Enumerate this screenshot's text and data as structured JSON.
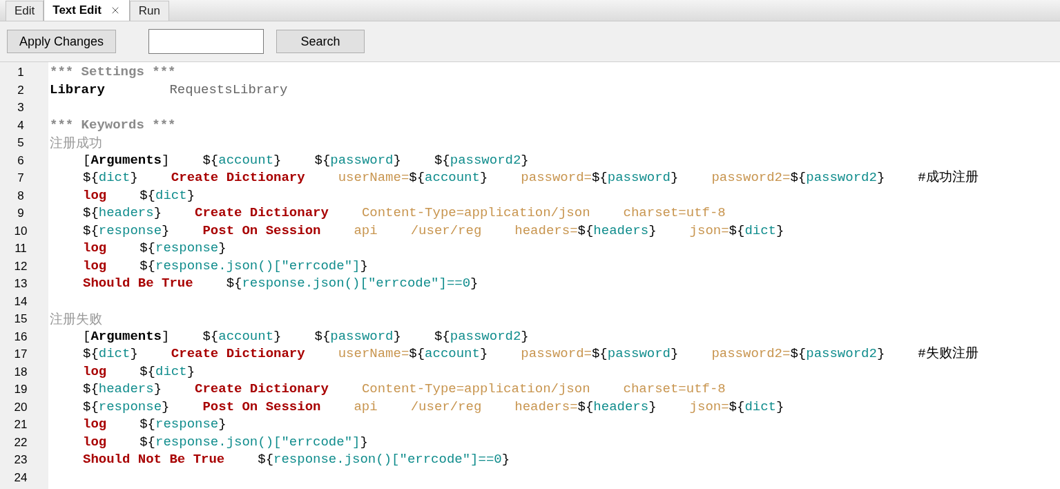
{
  "tabs": [
    {
      "label": "Edit",
      "selected": false
    },
    {
      "label": "Text Edit",
      "selected": true
    },
    {
      "label": "Run",
      "selected": false
    }
  ],
  "toolbar": {
    "apply_button": "Apply Changes",
    "search_button": "Search"
  },
  "editor": {
    "lines": [
      {
        "number": "1",
        "indented": false,
        "cells": [
          [
            {
              "kind": "section",
              "text": "*** Settings ***"
            }
          ]
        ]
      },
      {
        "number": "2",
        "indented": false,
        "cells": [
          [
            {
              "kind": "setting",
              "text": "Library"
            }
          ],
          [
            {
              "kind": "plain",
              "text": "    RequestsLibrary"
            }
          ]
        ]
      },
      {
        "number": "3"
      },
      {
        "number": "4",
        "indented": false,
        "cells": [
          [
            {
              "kind": "section",
              "text": "*** Keywords ***"
            }
          ]
        ]
      },
      {
        "number": "5",
        "indented": false,
        "cells": [
          [
            {
              "kind": "name",
              "text": "注册成功"
            }
          ]
        ]
      },
      {
        "number": "6",
        "indented": true,
        "cells": [
          [
            {
              "kind": "brace",
              "text": "["
            },
            {
              "kind": "setting",
              "text": "Arguments"
            },
            {
              "kind": "brace",
              "text": "]"
            }
          ],
          [
            {
              "kind": "brace",
              "text": "${"
            },
            {
              "kind": "var",
              "text": "account"
            },
            {
              "kind": "brace",
              "text": "}"
            }
          ],
          [
            {
              "kind": "brace",
              "text": "${"
            },
            {
              "kind": "var",
              "text": "password"
            },
            {
              "kind": "brace",
              "text": "}"
            }
          ],
          [
            {
              "kind": "brace",
              "text": "${"
            },
            {
              "kind": "var",
              "text": "password2"
            },
            {
              "kind": "brace",
              "text": "}"
            }
          ]
        ]
      },
      {
        "number": "7",
        "indented": true,
        "cells": [
          [
            {
              "kind": "brace",
              "text": "${"
            },
            {
              "kind": "var",
              "text": "dict"
            },
            {
              "kind": "brace",
              "text": "}"
            }
          ],
          [
            {
              "kind": "keyword",
              "text": "Create Dictionary"
            }
          ],
          [
            {
              "kind": "arg",
              "text": "userName="
            },
            {
              "kind": "brace",
              "text": "${"
            },
            {
              "kind": "var",
              "text": "account"
            },
            {
              "kind": "brace",
              "text": "}"
            }
          ],
          [
            {
              "kind": "arg",
              "text": "password="
            },
            {
              "kind": "brace",
              "text": "${"
            },
            {
              "kind": "var",
              "text": "password"
            },
            {
              "kind": "brace",
              "text": "}"
            }
          ],
          [
            {
              "kind": "arg",
              "text": "password2="
            },
            {
              "kind": "brace",
              "text": "${"
            },
            {
              "kind": "var",
              "text": "password2"
            },
            {
              "kind": "brace",
              "text": "}"
            }
          ],
          [
            {
              "kind": "comment",
              "text": "#成功注册"
            }
          ]
        ]
      },
      {
        "number": "8",
        "indented": true,
        "cells": [
          [
            {
              "kind": "keyword",
              "text": "log"
            }
          ],
          [
            {
              "kind": "brace",
              "text": "${"
            },
            {
              "kind": "var",
              "text": "dict"
            },
            {
              "kind": "brace",
              "text": "}"
            }
          ]
        ]
      },
      {
        "number": "9",
        "indented": true,
        "cells": [
          [
            {
              "kind": "brace",
              "text": "${"
            },
            {
              "kind": "var",
              "text": "headers"
            },
            {
              "kind": "brace",
              "text": "}"
            }
          ],
          [
            {
              "kind": "keyword",
              "text": "Create Dictionary"
            }
          ],
          [
            {
              "kind": "arg",
              "text": "Content-Type=application/json"
            }
          ],
          [
            {
              "kind": "arg",
              "text": "charset=utf-8"
            }
          ]
        ]
      },
      {
        "number": "10",
        "indented": true,
        "cells": [
          [
            {
              "kind": "brace",
              "text": "${"
            },
            {
              "kind": "var",
              "text": "response"
            },
            {
              "kind": "brace",
              "text": "}"
            }
          ],
          [
            {
              "kind": "keyword",
              "text": "Post On Session"
            }
          ],
          [
            {
              "kind": "arg",
              "text": "api"
            }
          ],
          [
            {
              "kind": "arg",
              "text": "/user/reg"
            }
          ],
          [
            {
              "kind": "arg",
              "text": "headers="
            },
            {
              "kind": "brace",
              "text": "${"
            },
            {
              "kind": "var",
              "text": "headers"
            },
            {
              "kind": "brace",
              "text": "}"
            }
          ],
          [
            {
              "kind": "arg",
              "text": "json="
            },
            {
              "kind": "brace",
              "text": "${"
            },
            {
              "kind": "var",
              "text": "dict"
            },
            {
              "kind": "brace",
              "text": "}"
            }
          ]
        ]
      },
      {
        "number": "11",
        "indented": true,
        "cells": [
          [
            {
              "kind": "keyword",
              "text": "log"
            }
          ],
          [
            {
              "kind": "brace",
              "text": "${"
            },
            {
              "kind": "var",
              "text": "response"
            },
            {
              "kind": "brace",
              "text": "}"
            }
          ]
        ]
      },
      {
        "number": "12",
        "indented": true,
        "cells": [
          [
            {
              "kind": "keyword",
              "text": "log"
            }
          ],
          [
            {
              "kind": "brace",
              "text": "${"
            },
            {
              "kind": "var",
              "text": "response.json()[\"errcode\"]"
            },
            {
              "kind": "brace",
              "text": "}"
            }
          ]
        ]
      },
      {
        "number": "13",
        "indented": true,
        "cells": [
          [
            {
              "kind": "keyword",
              "text": "Should Be True"
            }
          ],
          [
            {
              "kind": "brace",
              "text": "${"
            },
            {
              "kind": "var",
              "text": "response.json()[\"errcode\"]==0"
            },
            {
              "kind": "brace",
              "text": "}"
            }
          ]
        ]
      },
      {
        "number": "14"
      },
      {
        "number": "15",
        "indented": false,
        "cells": [
          [
            {
              "kind": "name",
              "text": "注册失败"
            }
          ]
        ]
      },
      {
        "number": "16",
        "indented": true,
        "cells": [
          [
            {
              "kind": "brace",
              "text": "["
            },
            {
              "kind": "setting",
              "text": "Arguments"
            },
            {
              "kind": "brace",
              "text": "]"
            }
          ],
          [
            {
              "kind": "brace",
              "text": "${"
            },
            {
              "kind": "var",
              "text": "account"
            },
            {
              "kind": "brace",
              "text": "}"
            }
          ],
          [
            {
              "kind": "brace",
              "text": "${"
            },
            {
              "kind": "var",
              "text": "password"
            },
            {
              "kind": "brace",
              "text": "}"
            }
          ],
          [
            {
              "kind": "brace",
              "text": "${"
            },
            {
              "kind": "var",
              "text": "password2"
            },
            {
              "kind": "brace",
              "text": "}"
            }
          ]
        ]
      },
      {
        "number": "17",
        "indented": true,
        "cells": [
          [
            {
              "kind": "brace",
              "text": "${"
            },
            {
              "kind": "var",
              "text": "dict"
            },
            {
              "kind": "brace",
              "text": "}"
            }
          ],
          [
            {
              "kind": "keyword",
              "text": "Create Dictionary"
            }
          ],
          [
            {
              "kind": "arg",
              "text": "userName="
            },
            {
              "kind": "brace",
              "text": "${"
            },
            {
              "kind": "var",
              "text": "account"
            },
            {
              "kind": "brace",
              "text": "}"
            }
          ],
          [
            {
              "kind": "arg",
              "text": "password="
            },
            {
              "kind": "brace",
              "text": "${"
            },
            {
              "kind": "var",
              "text": "password"
            },
            {
              "kind": "brace",
              "text": "}"
            }
          ],
          [
            {
              "kind": "arg",
              "text": "password2="
            },
            {
              "kind": "brace",
              "text": "${"
            },
            {
              "kind": "var",
              "text": "password2"
            },
            {
              "kind": "brace",
              "text": "}"
            }
          ],
          [
            {
              "kind": "comment",
              "text": "#失败注册"
            }
          ]
        ]
      },
      {
        "number": "18",
        "indented": true,
        "cells": [
          [
            {
              "kind": "keyword",
              "text": "log"
            }
          ],
          [
            {
              "kind": "brace",
              "text": "${"
            },
            {
              "kind": "var",
              "text": "dict"
            },
            {
              "kind": "brace",
              "text": "}"
            }
          ]
        ]
      },
      {
        "number": "19",
        "indented": true,
        "cells": [
          [
            {
              "kind": "brace",
              "text": "${"
            },
            {
              "kind": "var",
              "text": "headers"
            },
            {
              "kind": "brace",
              "text": "}"
            }
          ],
          [
            {
              "kind": "keyword",
              "text": "Create Dictionary"
            }
          ],
          [
            {
              "kind": "arg",
              "text": "Content-Type=application/json"
            }
          ],
          [
            {
              "kind": "arg",
              "text": "charset=utf-8"
            }
          ]
        ]
      },
      {
        "number": "20",
        "indented": true,
        "cells": [
          [
            {
              "kind": "brace",
              "text": "${"
            },
            {
              "kind": "var",
              "text": "response"
            },
            {
              "kind": "brace",
              "text": "}"
            }
          ],
          [
            {
              "kind": "keyword",
              "text": "Post On Session"
            }
          ],
          [
            {
              "kind": "arg",
              "text": "api"
            }
          ],
          [
            {
              "kind": "arg",
              "text": "/user/reg"
            }
          ],
          [
            {
              "kind": "arg",
              "text": "headers="
            },
            {
              "kind": "brace",
              "text": "${"
            },
            {
              "kind": "var",
              "text": "headers"
            },
            {
              "kind": "brace",
              "text": "}"
            }
          ],
          [
            {
              "kind": "arg",
              "text": "json="
            },
            {
              "kind": "brace",
              "text": "${"
            },
            {
              "kind": "var",
              "text": "dict"
            },
            {
              "kind": "brace",
              "text": "}"
            }
          ]
        ]
      },
      {
        "number": "21",
        "indented": true,
        "cells": [
          [
            {
              "kind": "keyword",
              "text": "log"
            }
          ],
          [
            {
              "kind": "brace",
              "text": "${"
            },
            {
              "kind": "var",
              "text": "response"
            },
            {
              "kind": "brace",
              "text": "}"
            }
          ]
        ]
      },
      {
        "number": "22",
        "indented": true,
        "cells": [
          [
            {
              "kind": "keyword",
              "text": "log"
            }
          ],
          [
            {
              "kind": "brace",
              "text": "${"
            },
            {
              "kind": "var",
              "text": "response.json()[\"errcode\"]"
            },
            {
              "kind": "brace",
              "text": "}"
            }
          ]
        ]
      },
      {
        "number": "23",
        "indented": true,
        "cells": [
          [
            {
              "kind": "keyword",
              "text": "Should Not Be True"
            }
          ],
          [
            {
              "kind": "brace",
              "text": "${"
            },
            {
              "kind": "var",
              "text": "response.json()[\"errcode\"]==0"
            },
            {
              "kind": "brace",
              "text": "}"
            }
          ]
        ]
      },
      {
        "number": "24"
      }
    ]
  }
}
